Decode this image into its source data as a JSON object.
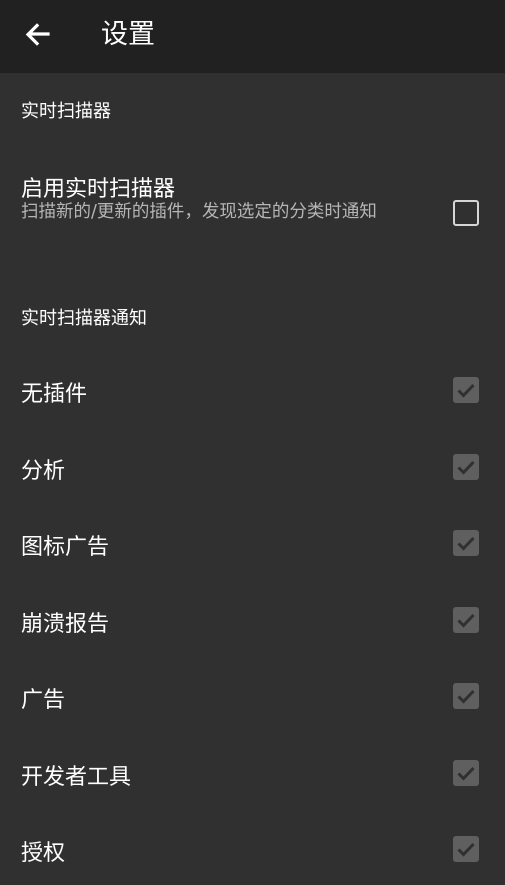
{
  "toolbar": {
    "title": "设置",
    "back_icon": "arrow-back-icon"
  },
  "colors": {
    "background": "#303030",
    "appbar": "#212121",
    "secondary_text": "#b5b5b5",
    "checkbox_disabled": "#5f5f5f"
  },
  "sections": {
    "realtime_scanner": "实时扫描器",
    "realtime_notifications": "实时扫描器通知"
  },
  "enable_scanner": {
    "title": "启用实时扫描器",
    "summary": "扫描新的/更新的插件，发现选定的分类时通知",
    "checked": false
  },
  "notify_items": [
    {
      "label": "无插件",
      "checked": true,
      "enabled": false
    },
    {
      "label": "分析",
      "checked": true,
      "enabled": false
    },
    {
      "label": "图标广告",
      "checked": true,
      "enabled": false
    },
    {
      "label": "崩溃报告",
      "checked": true,
      "enabled": false
    },
    {
      "label": "广告",
      "checked": true,
      "enabled": false
    },
    {
      "label": "开发者工具",
      "checked": true,
      "enabled": false
    },
    {
      "label": "授权",
      "checked": true,
      "enabled": false
    }
  ]
}
